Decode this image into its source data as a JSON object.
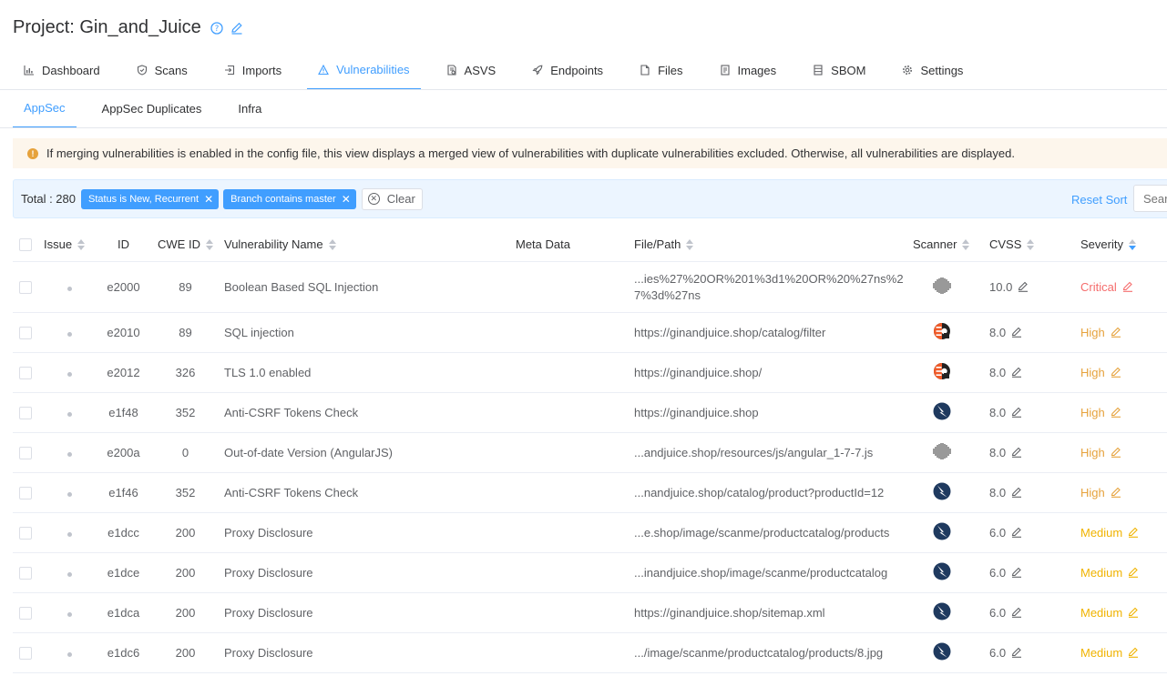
{
  "project": {
    "title": "Project: Gin_and_Juice"
  },
  "tabs": [
    {
      "label": "Dashboard",
      "icon": "chart-icon"
    },
    {
      "label": "Scans",
      "icon": "shield-icon"
    },
    {
      "label": "Imports",
      "icon": "import-icon"
    },
    {
      "label": "Vulnerabilities",
      "icon": "warning-icon"
    },
    {
      "label": "ASVS",
      "icon": "document-check-icon"
    },
    {
      "label": "Endpoints",
      "icon": "rocket-icon"
    },
    {
      "label": "Files",
      "icon": "file-icon"
    },
    {
      "label": "Images",
      "icon": "image-doc-icon"
    },
    {
      "label": "SBOM",
      "icon": "server-icon"
    },
    {
      "label": "Settings",
      "icon": "gear-icon"
    }
  ],
  "subtabs": [
    "AppSec",
    "AppSec Duplicates",
    "Infra"
  ],
  "alert": {
    "text": "If merging vulnerabilities is enabled in the config file, this view displays a merged view of vulnerabilities with duplicate vulnerabilities excluded. Otherwise, all vulnerabilities are displayed."
  },
  "filters": {
    "total": "Total : 280",
    "chips": [
      "Status is New, Recurrent",
      "Branch contains master"
    ],
    "clear": "Clear",
    "reset_sort": "Reset Sort",
    "search_placeholder": "Search"
  },
  "columns": [
    "Issue",
    "ID",
    "CWE ID",
    "Vulnerability Name",
    "Meta Data",
    "File/Path",
    "Scanner",
    "CVSS",
    "Severity"
  ],
  "rows": [
    {
      "id": "e2000",
      "cwe": "89",
      "name": "Boolean Based SQL Injection",
      "path": "...ies%27%20OR%201%3d1%20OR%20%27ns%27%3d%27ns",
      "scanner": "barcode",
      "cvss": "10.0",
      "severity": "Critical",
      "level": "critical"
    },
    {
      "id": "e2010",
      "cwe": "89",
      "name": "SQL injection",
      "path": "https://ginandjuice.shop/catalog/filter",
      "scanner": "burp",
      "cvss": "8.0",
      "severity": "High",
      "level": "high"
    },
    {
      "id": "e2012",
      "cwe": "326",
      "name": "TLS 1.0 enabled",
      "path": "https://ginandjuice.shop/",
      "scanner": "burp",
      "cvss": "8.0",
      "severity": "High",
      "level": "high"
    },
    {
      "id": "e1f48",
      "cwe": "352",
      "name": "Anti-CSRF Tokens Check",
      "path": "https://ginandjuice.shop",
      "scanner": "zap",
      "cvss": "8.0",
      "severity": "High",
      "level": "high"
    },
    {
      "id": "e200a",
      "cwe": "0",
      "name": "Out-of-date Version (AngularJS)",
      "path": "...andjuice.shop/resources/js/angular_1-7-7.js",
      "scanner": "barcode",
      "cvss": "8.0",
      "severity": "High",
      "level": "high"
    },
    {
      "id": "e1f46",
      "cwe": "352",
      "name": "Anti-CSRF Tokens Check",
      "path": "...nandjuice.shop/catalog/product?productId=12",
      "scanner": "zap",
      "cvss": "8.0",
      "severity": "High",
      "level": "high"
    },
    {
      "id": "e1dcc",
      "cwe": "200",
      "name": "Proxy Disclosure",
      "path": "...e.shop/image/scanme/productcatalog/products",
      "scanner": "zap",
      "cvss": "6.0",
      "severity": "Medium",
      "level": "medium"
    },
    {
      "id": "e1dce",
      "cwe": "200",
      "name": "Proxy Disclosure",
      "path": "...inandjuice.shop/image/scanme/productcatalog",
      "scanner": "zap",
      "cvss": "6.0",
      "severity": "Medium",
      "level": "medium"
    },
    {
      "id": "e1dca",
      "cwe": "200",
      "name": "Proxy Disclosure",
      "path": "https://ginandjuice.shop/sitemap.xml",
      "scanner": "zap",
      "cvss": "6.0",
      "severity": "Medium",
      "level": "medium"
    },
    {
      "id": "e1dc6",
      "cwe": "200",
      "name": "Proxy Disclosure",
      "path": ".../image/scanme/productcatalog/products/8.jpg",
      "scanner": "zap",
      "cvss": "6.0",
      "severity": "Medium",
      "level": "medium"
    }
  ],
  "colors": {
    "accent": "#409eff",
    "critical": "#f56c6c",
    "high": "#e6a23c",
    "medium": "#f0b300"
  }
}
